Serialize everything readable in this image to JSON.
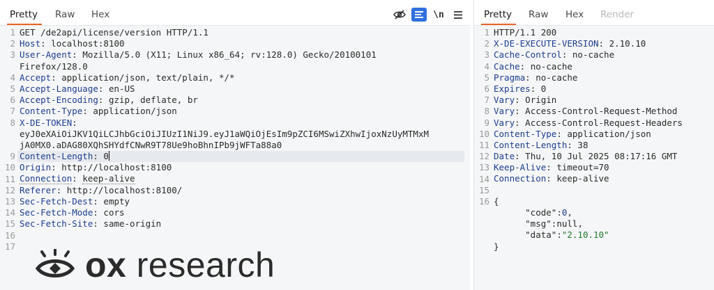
{
  "request": {
    "tabs": [
      "Pretty",
      "Raw",
      "Hex"
    ],
    "active_tab": "Pretty",
    "newline_label": "\\n",
    "line_numbers": [
      "1",
      "2",
      "3",
      "",
      "4",
      "5",
      "6",
      "7",
      "8",
      "",
      "",
      "9",
      "10",
      "11",
      "12",
      "13",
      "14",
      "15",
      "16",
      "17"
    ],
    "lines": [
      {
        "plain": "GET /de2api/license/version HTTP/1.1"
      },
      {
        "key": "Host",
        "value": "localhost:8100"
      },
      {
        "key": "User-Agent",
        "value": "Mozilla/5.0 (X11; Linux x86_64; rv:128.0) Gecko/20100101"
      },
      {
        "plain": "Firefox/128.0"
      },
      {
        "key": "Accept",
        "value": "application/json, text/plain, */*"
      },
      {
        "key": "Accept-Language",
        "value": "en-US"
      },
      {
        "key": "Accept-Encoding",
        "value": "gzip, deflate, br"
      },
      {
        "key": "Content-Type",
        "value": "application/json"
      },
      {
        "key": "X-DE-TOKEN",
        "value": ""
      },
      {
        "plain": "eyJ0eXAiOiJKV1QiLCJhbGciOiJIUzI1NiJ9.eyJ1aWQiOjEsIm9pZCI6MSwiZXhwIjoxNzUyMTMxM"
      },
      {
        "plain": "jA0MX0.aDAG80XQhSHYdfCNwR9T78Ue9hoBhnIPb9jWFTa88a0"
      },
      {
        "key": "Content-Length",
        "value": "0"
      },
      {
        "key": "Origin",
        "value": "http://localhost:8100"
      },
      {
        "key": "Connection",
        "value": "keep-alive"
      },
      {
        "key": "Referer",
        "value": "http://localhost:8100/"
      },
      {
        "key": "Sec-Fetch-Dest",
        "value": "empty"
      },
      {
        "key": "Sec-Fetch-Mode",
        "value": "cors"
      },
      {
        "key": "Sec-Fetch-Site",
        "value": "same-origin"
      },
      {
        "plain": ""
      },
      {
        "plain": ""
      }
    ]
  },
  "response": {
    "tabs": [
      "Pretty",
      "Raw",
      "Hex",
      "Render"
    ],
    "active_tab": "Pretty",
    "disabled_tab": "Render",
    "line_numbers": [
      "1",
      "2",
      "3",
      "4",
      "5",
      "6",
      "7",
      "8",
      "9",
      "10",
      "11",
      "12",
      "13",
      "14",
      "15",
      "16",
      "",
      "",
      "",
      ""
    ],
    "lines": [
      {
        "plain": "HTTP/1.1 200"
      },
      {
        "key": "X-DE-EXECUTE-VERSION",
        "value": "2.10.10"
      },
      {
        "key": "Cache-Control",
        "value": "no-cache"
      },
      {
        "key": "Cache",
        "value": "no-cache"
      },
      {
        "key": "Pragma",
        "value": "no-cache"
      },
      {
        "key": "Expires",
        "value": "0"
      },
      {
        "key": "Vary",
        "value": "Origin"
      },
      {
        "key": "Vary",
        "value": "Access-Control-Request-Method"
      },
      {
        "key": "Vary",
        "value": "Access-Control-Request-Headers"
      },
      {
        "key": "Content-Type",
        "value": "application/json"
      },
      {
        "key": "Content-Length",
        "value": "38"
      },
      {
        "key": "Date",
        "value": "Thu, 10 Jul 2025 08:17:16 GMT"
      },
      {
        "key": "Keep-Alive",
        "value": "timeout=70"
      },
      {
        "key": "Connection",
        "value": "keep-alive"
      },
      {
        "plain": ""
      },
      {
        "plain": "{"
      },
      {
        "json_key": "\"code\"",
        "json_value": "0",
        "kind": "num",
        "comma": ","
      },
      {
        "json_key": "\"msg\"",
        "json_value": "null",
        "kind": "null",
        "comma": ","
      },
      {
        "json_key": "\"data\"",
        "json_value": "\"2.10.10\"",
        "kind": "str",
        "comma": ""
      },
      {
        "plain": "}"
      }
    ]
  },
  "branding": {
    "logo_bold": "ox",
    "logo_regular": "research"
  }
}
